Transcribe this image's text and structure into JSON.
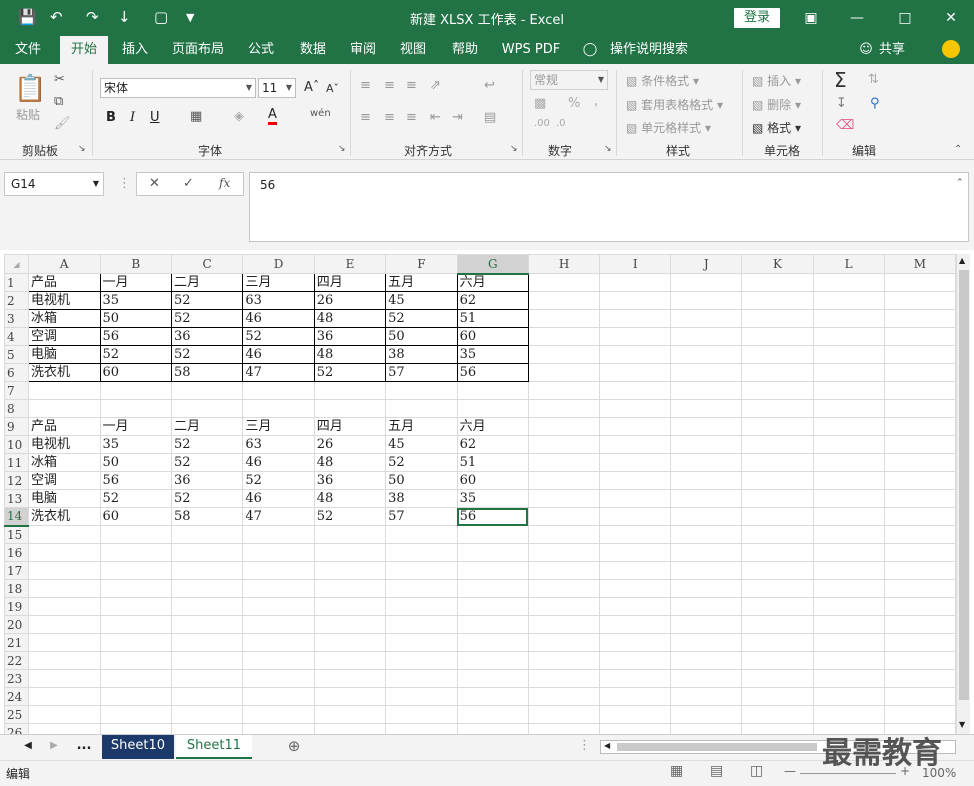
{
  "window": {
    "title": "新建 XLSX 工作表 - Excel",
    "login": "登录",
    "accent": "#217346"
  },
  "ribbon_tabs": [
    "文件",
    "开始",
    "插入",
    "页面布局",
    "公式",
    "数据",
    "审阅",
    "视图",
    "帮助",
    "WPS PDF",
    "操作说明搜索"
  ],
  "share_label": "共享",
  "ribbon": {
    "clipboard": {
      "label": "剪贴板",
      "paste": "粘贴"
    },
    "font": {
      "label": "字体",
      "name": "宋体",
      "size": "11"
    },
    "alignment": {
      "label": "对齐方式"
    },
    "number": {
      "label": "数字",
      "format": "常规"
    },
    "styles": {
      "label": "样式",
      "items": [
        "条件格式",
        "套用表格格式",
        "单元格样式"
      ]
    },
    "cells": {
      "label": "单元格",
      "items": [
        "插入",
        "删除",
        "格式"
      ]
    },
    "editing": {
      "label": "编辑"
    }
  },
  "formula_bar": {
    "name_box": "G14",
    "formula": "56"
  },
  "columns": [
    "A",
    "B",
    "C",
    "D",
    "E",
    "F",
    "G",
    "H",
    "I",
    "J",
    "K",
    "L",
    "M"
  ],
  "selected_column": "G",
  "active_cell": {
    "row": 14,
    "col": "G"
  },
  "rows": [
    [
      "产品",
      "一月",
      "二月",
      "三月",
      "四月",
      "五月",
      "六月"
    ],
    [
      "电视机",
      "35",
      "52",
      "63",
      "26",
      "45",
      "62"
    ],
    [
      "冰箱",
      "50",
      "52",
      "46",
      "48",
      "52",
      "51"
    ],
    [
      "空调",
      "56",
      "36",
      "52",
      "36",
      "50",
      "60"
    ],
    [
      "电脑",
      "52",
      "52",
      "46",
      "48",
      "38",
      "35"
    ],
    [
      "洗衣机",
      "60",
      "58",
      "47",
      "52",
      "57",
      "56"
    ],
    [],
    [],
    [
      "产品",
      "一月",
      "二月",
      "三月",
      "四月",
      "五月",
      "六月"
    ],
    [
      "电视机",
      "35",
      "52",
      "63",
      "26",
      "45",
      "62"
    ],
    [
      "冰箱",
      "50",
      "52",
      "46",
      "48",
      "52",
      "51"
    ],
    [
      "空调",
      "56",
      "36",
      "52",
      "36",
      "50",
      "60"
    ],
    [
      "电脑",
      "52",
      "52",
      "46",
      "48",
      "38",
      "35"
    ],
    [
      "洗衣机",
      "60",
      "58",
      "47",
      "52",
      "57",
      "56"
    ],
    [],
    [],
    [],
    [],
    [],
    [],
    [],
    [],
    [],
    [],
    [],
    []
  ],
  "sheets": {
    "more": "...",
    "tabs": [
      "Sheet10",
      "Sheet11"
    ],
    "active": "Sheet11"
  },
  "status": {
    "mode": "编辑",
    "zoom": "100%"
  },
  "watermark": "最需教育"
}
